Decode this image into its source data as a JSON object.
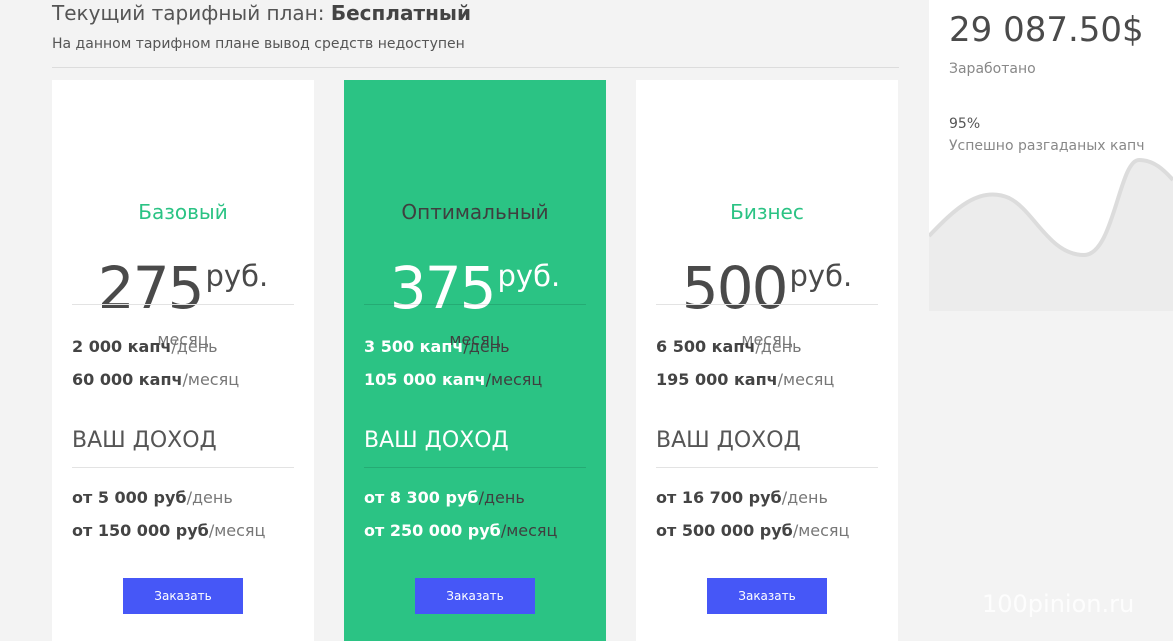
{
  "header": {
    "title_prefix": "Текущий тарифный план:",
    "title_plan": "Бесплатный",
    "subtitle": "На данном тарифном плане вывод средств недоступен"
  },
  "plans": [
    {
      "name": "Базовый",
      "price": "275",
      "currency": "руб.",
      "period": "месяц",
      "daily_amount": "2 000 капч",
      "daily_unit": "/день",
      "monthly_amount": "60 000 капч",
      "monthly_unit": "/месяц",
      "income_label": "ВАШ ДОХОД",
      "income_daily_amount": "от 5 000 руб",
      "income_daily_unit": "/день",
      "income_monthly_amount": "от 150 000 руб",
      "income_monthly_unit": "/месяц",
      "button": "Заказать"
    },
    {
      "name": "Оптимальный",
      "price": "375",
      "currency": "руб.",
      "period": "месяц",
      "daily_amount": "3 500 капч",
      "daily_unit": "/день",
      "monthly_amount": "105 000 капч",
      "monthly_unit": "/месяц",
      "income_label": "ВАШ ДОХОД",
      "income_daily_amount": "от 8 300 руб",
      "income_daily_unit": "/день",
      "income_monthly_amount": "от 250 000 руб",
      "income_monthly_unit": "/месяц",
      "button": "Заказать"
    },
    {
      "name": "Бизнес",
      "price": "500",
      "currency": "руб.",
      "period": "месяц",
      "daily_amount": "6 500 капч",
      "daily_unit": "/день",
      "monthly_amount": "195 000 капч",
      "monthly_unit": "/месяц",
      "income_label": "ВАШ ДОХОД",
      "income_daily_amount": "от 16 700 руб",
      "income_daily_unit": "/день",
      "income_monthly_amount": "от 500 000 руб",
      "income_monthly_unit": "/месяц",
      "button": "Заказать"
    }
  ],
  "sidebar": {
    "earned_amount": "29 087.50$",
    "earned_label": "Заработано",
    "success_percent": "95%",
    "success_label": "Успешно разгаданых капч",
    "success_value": 95
  },
  "watermark": "100pinion.ru",
  "colors": {
    "accent": "#2bc384",
    "button": "#4657f7",
    "background": "#f3f3f3"
  }
}
